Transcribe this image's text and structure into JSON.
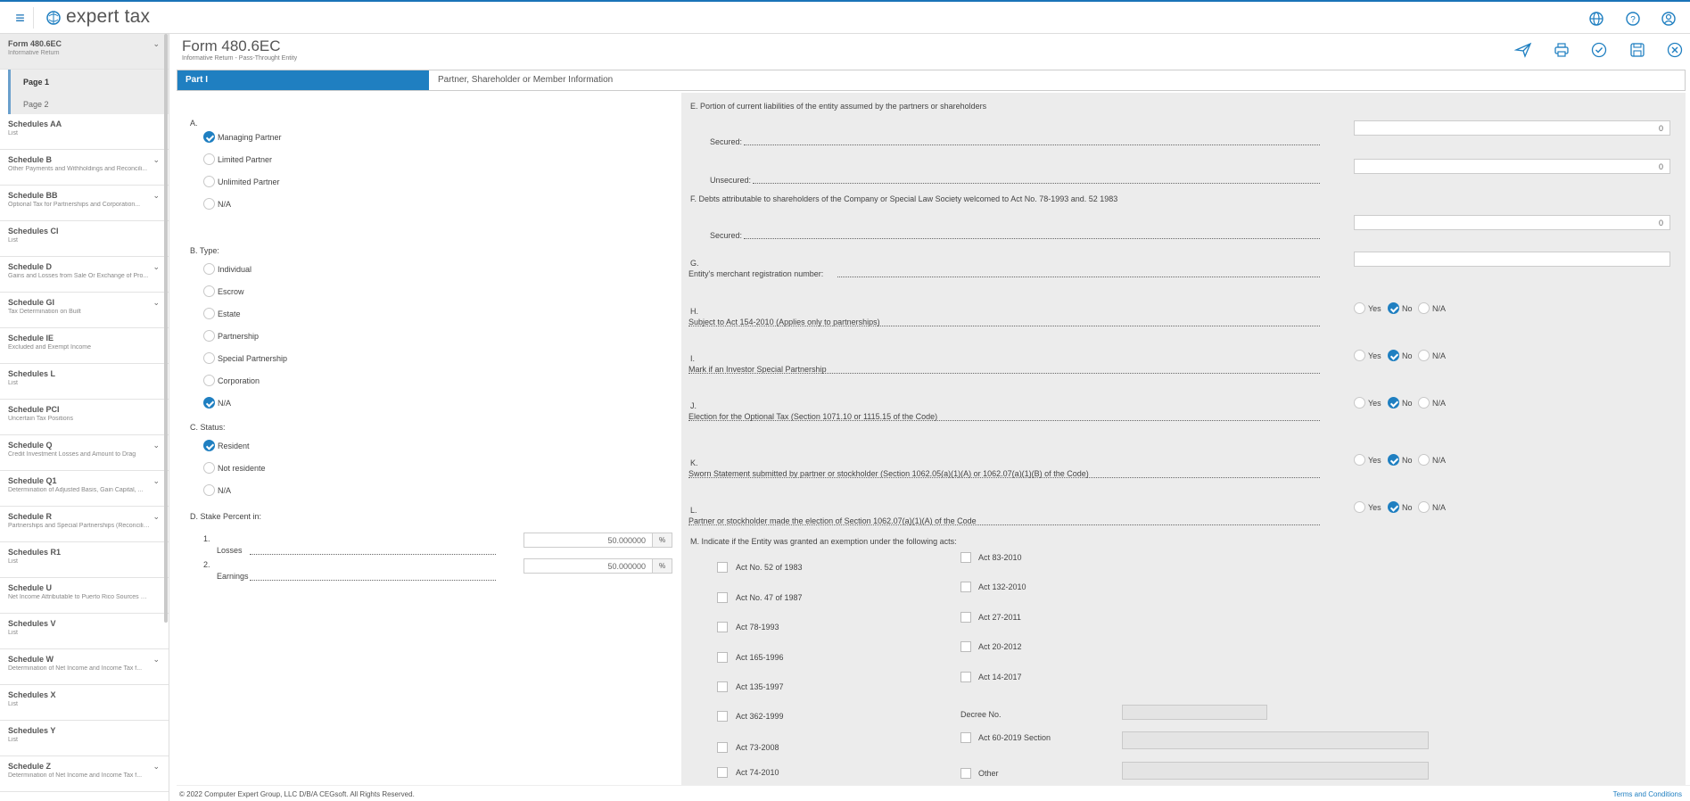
{
  "app": {
    "brand": "expert tax",
    "accent_color": "#1f7fc1"
  },
  "topbar": {
    "icons": [
      "menu-icon",
      "globe-icon",
      "help-icon",
      "user-icon"
    ]
  },
  "sidebar": {
    "form": {
      "title": "Form 480.6EC",
      "subtitle": "Informative Return"
    },
    "pages": [
      "Page 1",
      "Page 2"
    ],
    "items": [
      {
        "title": "Schedules AA",
        "subtitle": "List",
        "chevron": false
      },
      {
        "title": "Schedule B",
        "subtitle": "Other Payments and Withholdings and Reconcili...",
        "chevron": true
      },
      {
        "title": "Schedule BB",
        "subtitle": "Optional Tax for Partnerships and Corporation...",
        "chevron": true
      },
      {
        "title": "Schedules CI",
        "subtitle": "List",
        "chevron": false
      },
      {
        "title": "Schedule D",
        "subtitle": "Gains and Losses from Sale Or Exchange of Pro...",
        "chevron": true
      },
      {
        "title": "Schedule GI",
        "subtitle": "Tax Determination on Built",
        "chevron": true
      },
      {
        "title": "Schedule IE",
        "subtitle": "Excluded and Exempt Income",
        "chevron": false
      },
      {
        "title": "Schedules L",
        "subtitle": "List",
        "chevron": false
      },
      {
        "title": "Schedule PCI",
        "subtitle": "Uncertain Tax Positions",
        "chevron": false
      },
      {
        "title": "Schedule Q",
        "subtitle": "Credit Investment Losses and Amount to Drag",
        "chevron": true
      },
      {
        "title": "Schedule Q1",
        "subtitle": "Determination of Adjusted Basis, Gain Capital, ...",
        "chevron": true
      },
      {
        "title": "Schedule R",
        "subtitle": "Partnerships and Special Partnerships (Reconciliati...",
        "chevron": true
      },
      {
        "title": "Schedules R1",
        "subtitle": "List",
        "chevron": false
      },
      {
        "title": "Schedule U",
        "subtitle": "Net Income Attributable to Puerto Rico Sources Pu...",
        "chevron": false
      },
      {
        "title": "Schedules V",
        "subtitle": "List",
        "chevron": false
      },
      {
        "title": "Schedule W",
        "subtitle": "Determination of Net Income and Income Tax f...",
        "chevron": true
      },
      {
        "title": "Schedules X",
        "subtitle": "List",
        "chevron": false
      },
      {
        "title": "Schedules Y",
        "subtitle": "List",
        "chevron": false
      },
      {
        "title": "Schedule Z",
        "subtitle": "Determination of Net Income and Income Tax f...",
        "chevron": true
      }
    ]
  },
  "header": {
    "title": "Form 480.6EC",
    "subtitle": "Informative Return - Pass-Throught Entity",
    "tools": [
      "send-icon",
      "print-icon",
      "check-icon",
      "save-icon",
      "close-icon"
    ]
  },
  "part": {
    "tab": "Part I",
    "title": "Partner, Shareholder or Member Information"
  },
  "left": {
    "A": {
      "label": "A.",
      "options": [
        "Managing Partner",
        "Limited Partner",
        "Unlimited Partner",
        "N/A"
      ],
      "selected": "Managing Partner"
    },
    "B": {
      "label": "B.  Type:",
      "options": [
        "Individual",
        "Escrow",
        "Estate",
        "Partnership",
        "Special Partnership",
        "Corporation",
        "N/A"
      ],
      "selected": "N/A"
    },
    "C": {
      "label": "C.  Status:",
      "options": [
        "Resident",
        "Not residente",
        "N/A"
      ],
      "selected": "Resident"
    },
    "D": {
      "label": "D.  Stake Percent in:",
      "rows": [
        {
          "num": "1.",
          "label": "Losses",
          "value": "50.000000",
          "unit": "%"
        },
        {
          "num": "2.",
          "label": "Earnings",
          "value": "50.000000",
          "unit": "%"
        }
      ]
    }
  },
  "right": {
    "E": {
      "label": "E.  Portion of current liabilities of the entity assumed by the partners or shareholders",
      "secured": "Secured:",
      "secured_value": "0",
      "unsecured": "Unsecured:",
      "unsecured_value": "0"
    },
    "F": {
      "label": "F.  Debts attributable to shareholders of the Company or Special Law Society welcomed to Act No. 78-1993 and. 52 1983",
      "secured": "Secured:",
      "secured_value": "0"
    },
    "G": {
      "letter": "G.",
      "label": "Entity's merchant registration number:",
      "value": ""
    },
    "yn": [
      {
        "letter": "H.",
        "label": "Subject to Act 154-2010 (Applies only to partnerships)",
        "selected": "No"
      },
      {
        "letter": "I.",
        "label": "Mark if an Investor Special Partnership",
        "selected": "No"
      },
      {
        "letter": "J.",
        "label": "Election for the Optional Tax (Section 1071.10 or 1115.15 of the Code)",
        "selected": "No"
      },
      {
        "letter": "K.",
        "label": "Sworn Statement submitted by partner or stockholder (Section 1062.05(a)(1)(A) or 1062.07(a)(1)(B) of the Code)",
        "selected": "No"
      },
      {
        "letter": "L.",
        "label": "Partner or stockholder made the election of Section 1062.07(a)(1)(A) of the Code",
        "selected": "No"
      }
    ],
    "yn_options": [
      "Yes",
      "No",
      "N/A"
    ],
    "M": {
      "label": "M.  Indicate if the Entity was granted an exemption under the following acts:",
      "col1": [
        "Act No. 52 of 1983",
        "Act No. 47 of 1987",
        "Act 78-1993",
        "Act 165-1996",
        "Act 135-1997",
        "Act 362-1999",
        "Act 73-2008",
        "Act 74-2010"
      ],
      "col2": [
        "Act 83-2010",
        "Act 132-2010",
        "Act 27-2011",
        "Act 20-2012",
        "Act 14-2017"
      ],
      "decree": "Decree No.",
      "act60": "Act 60-2019 Section",
      "other": "Other"
    }
  },
  "footer": {
    "copyright": "© 2022 Computer Expert Group, LLC D/B/A CEGsoft. All Rights Reserved.",
    "terms": "Terms and Conditions"
  }
}
